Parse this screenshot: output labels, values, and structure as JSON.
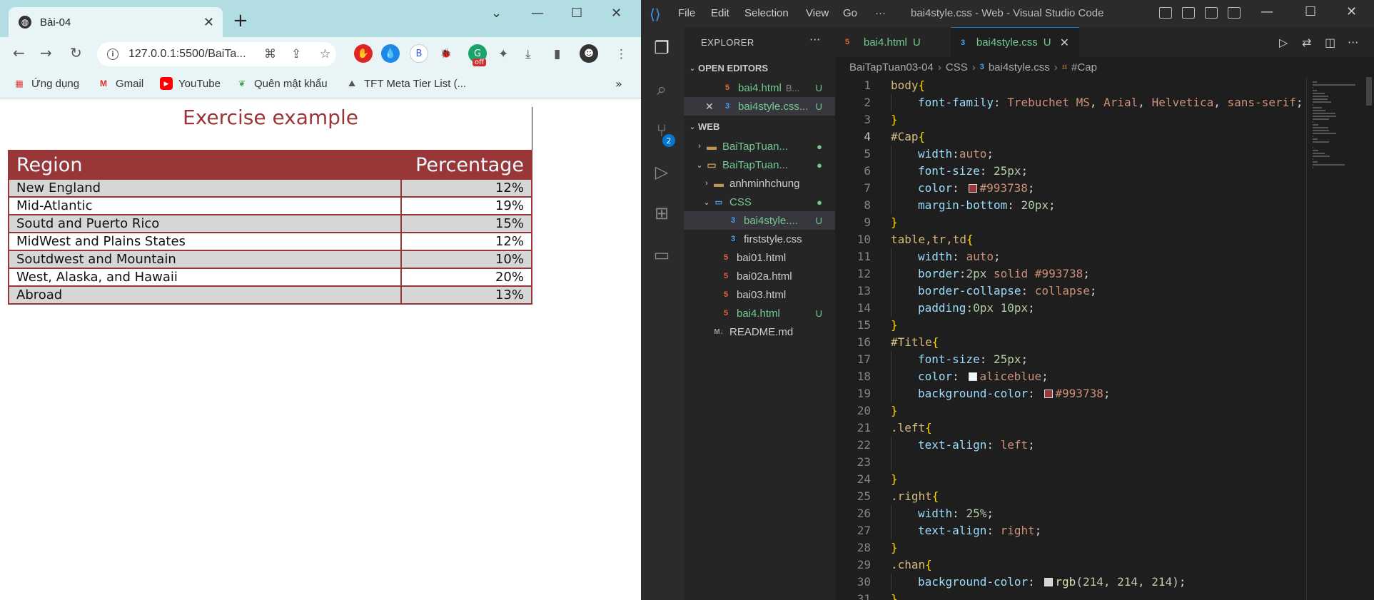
{
  "browser": {
    "tab_title": "Bài-04",
    "url": "127.0.0.1:5500/BaiTa...",
    "bookmarks": [
      {
        "label": "Ứng dụng"
      },
      {
        "label": "Gmail"
      },
      {
        "label": "YouTube"
      },
      {
        "label": "Quên mật khẩu"
      },
      {
        "label": "TFT Meta Tier List (..."
      }
    ],
    "ext_badge": "off",
    "profile_letter": "B"
  },
  "page": {
    "caption": "Exercise example",
    "headers": [
      "Region",
      "Percentage"
    ],
    "rows": [
      {
        "region": "New England",
        "pct": "12%"
      },
      {
        "region": "Mid-Atlantic",
        "pct": "19%"
      },
      {
        "region": "Soutd and Puerto Rico",
        "pct": "15%"
      },
      {
        "region": "MidWest and Plains States",
        "pct": "12%"
      },
      {
        "region": "Soutdwest and Mountain",
        "pct": "10%"
      },
      {
        "region": "West, Alaska, and Hawaii",
        "pct": "20%"
      },
      {
        "region": "Abroad",
        "pct": "13%"
      }
    ]
  },
  "vscode": {
    "menu": [
      "File",
      "Edit",
      "Selection",
      "View",
      "Go",
      "···"
    ],
    "window_title": "bai4style.css - Web - Visual Studio Code",
    "scm_badge": "2",
    "explorer_title": "EXPLORER",
    "open_editors_title": "OPEN EDITORS",
    "open_editors": [
      {
        "name": "bai4.html",
        "extra": "B...",
        "status": "U"
      },
      {
        "name": "bai4style.css...",
        "status": "U"
      }
    ],
    "workspace_title": "WEB",
    "tree": [
      {
        "name": "BaiTapTuan...",
        "kind": "folder",
        "open": false
      },
      {
        "name": "BaiTapTuan...",
        "kind": "folder",
        "open": true
      },
      {
        "name": "anhminhchung",
        "kind": "folder",
        "open": false
      },
      {
        "name": "CSS",
        "kind": "folder",
        "open": true
      },
      {
        "name": "bai4style....",
        "kind": "css",
        "status": "U"
      },
      {
        "name": "firststyle.css",
        "kind": "css"
      },
      {
        "name": "bai01.html",
        "kind": "html"
      },
      {
        "name": "bai02a.html",
        "kind": "html"
      },
      {
        "name": "bai03.html",
        "kind": "html"
      },
      {
        "name": "bai4.html",
        "kind": "html",
        "status": "U"
      },
      {
        "name": "README.md",
        "kind": "md"
      }
    ],
    "tabs": [
      {
        "name": "bai4.html",
        "status": "U"
      },
      {
        "name": "bai4style.css",
        "status": "U"
      }
    ],
    "breadcrumb": [
      "BaiTapTuan03-04",
      "CSS",
      "bai4style.css",
      "#Cap"
    ],
    "current_line": 4,
    "code": [
      "body{",
      "    font-family: Trebuchet MS, Arial, Helvetica, sans-serif;",
      "}",
      "#Cap{",
      "    width:auto;",
      "    font-size: 25px;",
      "    color: #993738;",
      "    margin-bottom: 20px;",
      "}",
      "table,tr,td{",
      "    width: auto;",
      "    border:2px solid #993738;",
      "    border-collapse: collapse;",
      "    padding:0px 10px;",
      "}",
      "#Title{",
      "    font-size: 25px;",
      "    color: aliceblue;",
      "    background-color: #993738;",
      "}",
      ".left{",
      "    text-align: left;",
      "",
      "}",
      ".right{",
      "    width: 25%;",
      "    text-align: right;",
      "}",
      ".chan{",
      "    background-color: rgb(214, 214, 214);",
      "}"
    ]
  },
  "colors": {
    "brand_red": "#993738",
    "aliceblue": "#f0f8ff",
    "grey_row": "#d6d6d6"
  }
}
